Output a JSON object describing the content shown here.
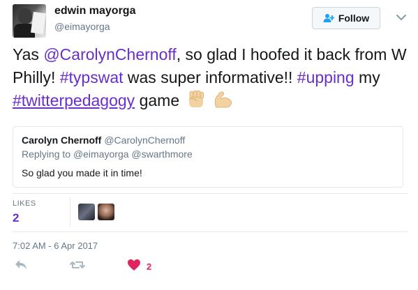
{
  "author": {
    "name": "edwin mayorga",
    "handle": "@eimayorga"
  },
  "follow": {
    "label": "Follow",
    "icon": "add-user-icon"
  },
  "tweet": {
    "parts": [
      {
        "text": "Yas ",
        "kind": "plain"
      },
      {
        "text": "@CarolynChernoff",
        "kind": "mention"
      },
      {
        "text": ", so glad I hoofed it back from W Philly! ",
        "kind": "plain"
      },
      {
        "text": "#typswat",
        "kind": "hashtag"
      },
      {
        "text": " was super informative!! ",
        "kind": "plain"
      },
      {
        "text": "#upping",
        "kind": "hashtag"
      },
      {
        "text": " my ",
        "kind": "plain"
      },
      {
        "text": "#twitterpedagogy",
        "kind": "hashtag-underlined"
      },
      {
        "text": " game",
        "kind": "plain"
      }
    ],
    "emojis": [
      "raised-fist-emoji",
      "flexed-biceps-emoji"
    ]
  },
  "quote": {
    "name": "Carolyn Chernoff",
    "handle": "@CarolynChernoff",
    "replying_prefix": "Replying to",
    "replying_to": [
      "@eimayorga",
      "@swarthmore"
    ],
    "text": "So glad you made it in time!"
  },
  "stats": {
    "likes_label": "LIKES",
    "likes_count": "2"
  },
  "timestamp": "7:02 AM - 6 Apr 2017",
  "actions": {
    "like_count": "2"
  },
  "colors": {
    "link": "#6a2ecb",
    "secondary": "#657786",
    "like": "#e0245e",
    "border": "#e1e8ed"
  }
}
